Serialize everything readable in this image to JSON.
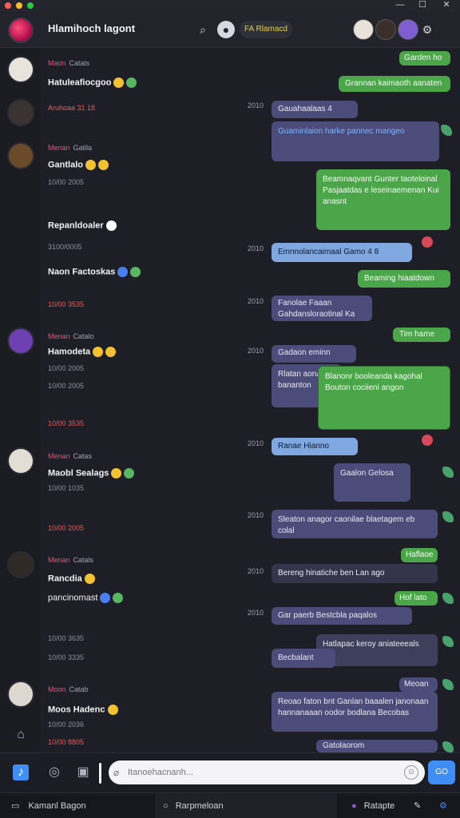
{
  "window": {
    "minimize": "—",
    "maximize": "☐",
    "close": "✕"
  },
  "header": {
    "title": "Hlamihoch lagont",
    "status": "FA Rlamacd"
  },
  "chat_list": [
    {
      "meta": "Maon",
      "sub": "Catals",
      "name": "Hatuleafiocgoo",
      "time": "Aruhoaa 31 18"
    },
    {
      "meta": "Menan",
      "sub": "Gatila",
      "name": "Gantlalo",
      "time": "10/00 2005"
    },
    {
      "name": "Repanldoaler",
      "time": "3100/0005"
    },
    {
      "name": "Naon Factoskas",
      "time": "10/00 3535"
    },
    {
      "meta": "Menan",
      "sub": "Catalo",
      "name": "Hamodeta",
      "time": "10/00 2005",
      "time2": "10/00 2005",
      "time3": "10/00 3535"
    },
    {
      "meta": "Menan",
      "sub": "Catas",
      "name": "Maobl Sealags",
      "time": "10/00 1035",
      "time2": "10/00 2005"
    },
    {
      "meta": "Menan",
      "sub": "Catals",
      "name": "Rancdia",
      "name2": "pancinomast",
      "time": "10/00 3635",
      "time2": "10/00 3335"
    },
    {
      "meta": "Moon",
      "sub": "Catab",
      "name": "Moos Hadenc",
      "time": "10/00 2036",
      "time2": "10/00 8805"
    }
  ],
  "messages": {
    "m1": "Garden ho",
    "m2": "Grannan kaimaoth aanaten",
    "m3": "Gauahaalaas 4",
    "m4": "Guaminlaion harke pannec mangeo",
    "m5": "Beamnaqvant Gunter taoteloinal Pasjaatdas e leseinaemenan Kui anasnt",
    "m6": "Emnnolancaimaal Gamo 4 8",
    "m7": "Beaming hiaatdown",
    "m8": "Fanolae Faaan Gahdansloraotinal Ka",
    "m9": "Tim hame",
    "m10": "Gadaon eminn",
    "m11": "Rlatan aonaon bananton",
    "m12": "Blanonr booleanda kagohal Bouton cociieni angon",
    "m13": "Ranae Hianno",
    "m14": "Gaalon Gelosa",
    "m15": "Sleaton anagor caonilae blaetagem eb colal",
    "m16": "Haflaoe",
    "m17": "Bereng hinatiche ben Lan ago",
    "m18": "Hof lato",
    "m19": "Gar paerb Bestcbla paqalos",
    "m20": "Hatlapac keroy aniateeeals",
    "m21": "Becbalant",
    "m22": "Meoan",
    "m23": "Reoao faton bnt Ganlan baaalen janonaan hannanaaan oodor bodlana Becobas",
    "m24": "Gatolaorom"
  },
  "timestamps": [
    "2010",
    "2010",
    "2010",
    "2010",
    "2010",
    "2010",
    "2010",
    "2010"
  ],
  "composer": {
    "placeholder": "Itanoehacnanh...",
    "send": "GO"
  },
  "statusbar": {
    "left": "Kamanl Bagon",
    "mid": "Rarpmeloan",
    "right": "Ratapte"
  }
}
